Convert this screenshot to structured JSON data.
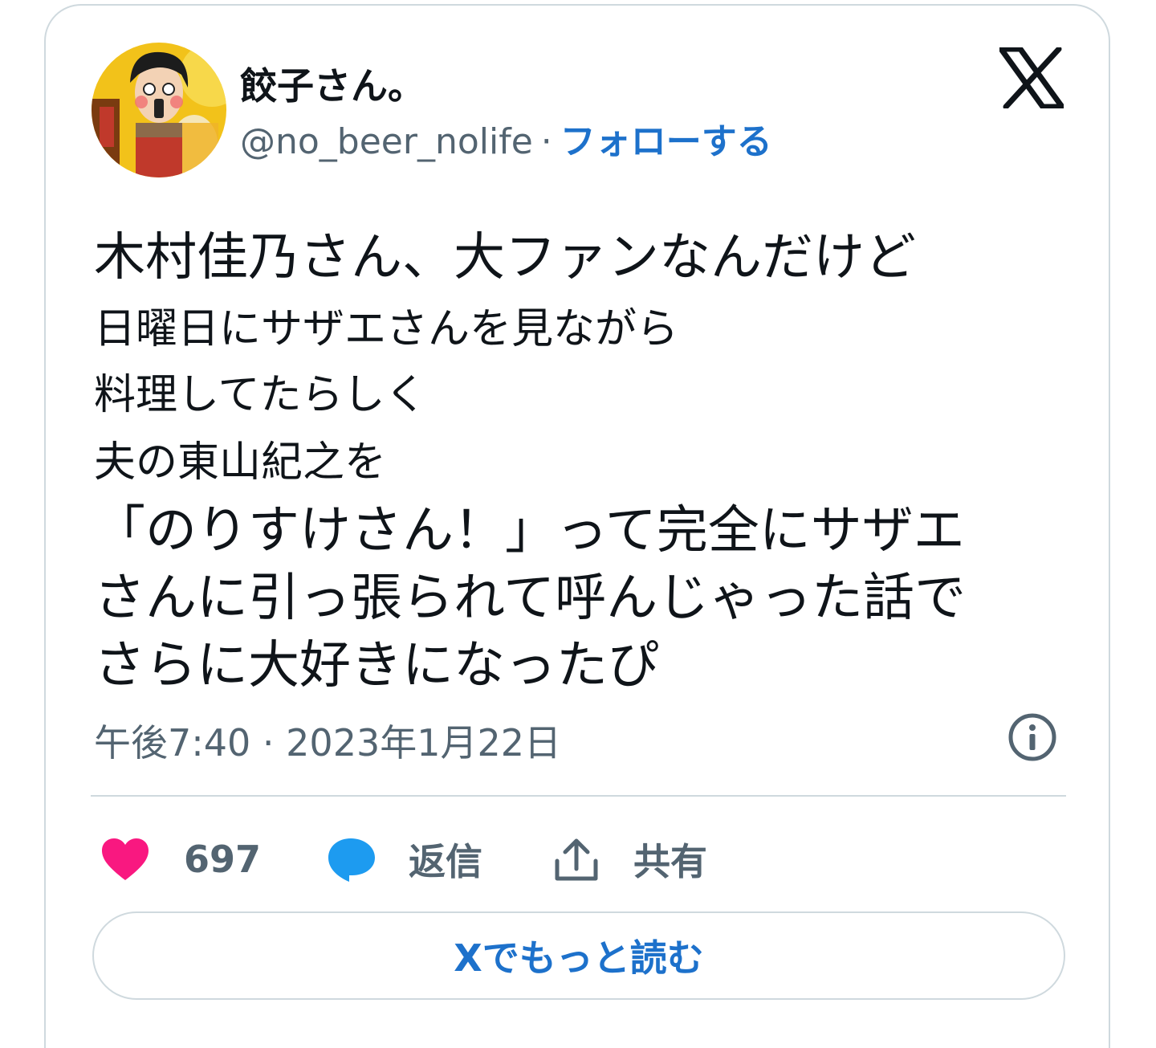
{
  "author": {
    "display_name": "餃子さん。",
    "handle": "@no_beer_nolife",
    "separator": "·",
    "follow_label": "フォローする"
  },
  "tweet": {
    "lines": [
      "木村佳乃さん、大ファンなんだけど",
      "日曜日にサザエさんを見ながら",
      "料理してたらしく",
      "夫の東山紀之を",
      "「のりすけさん！」って完全にサザエ",
      "さんに引っ張られて呼んじゃった話で",
      "さらに大好きになったぴ"
    ]
  },
  "meta": {
    "timestamp": "午後7:40 · 2023年1月22日"
  },
  "actions": {
    "like_count": "697",
    "reply_label": "返信",
    "share_label": "共有"
  },
  "read_more_label": "Xでもっと読む",
  "colors": {
    "text": "#0f1419",
    "secondary": "#536471",
    "accent": "#1d71cb",
    "like": "#f91880",
    "reply": "#1d9bf0",
    "border": "#cfd9de"
  },
  "icons": {
    "brand": "x-logo-icon",
    "info": "info-icon",
    "like": "heart-icon",
    "reply": "speech-bubble-icon",
    "share": "share-upload-icon"
  }
}
